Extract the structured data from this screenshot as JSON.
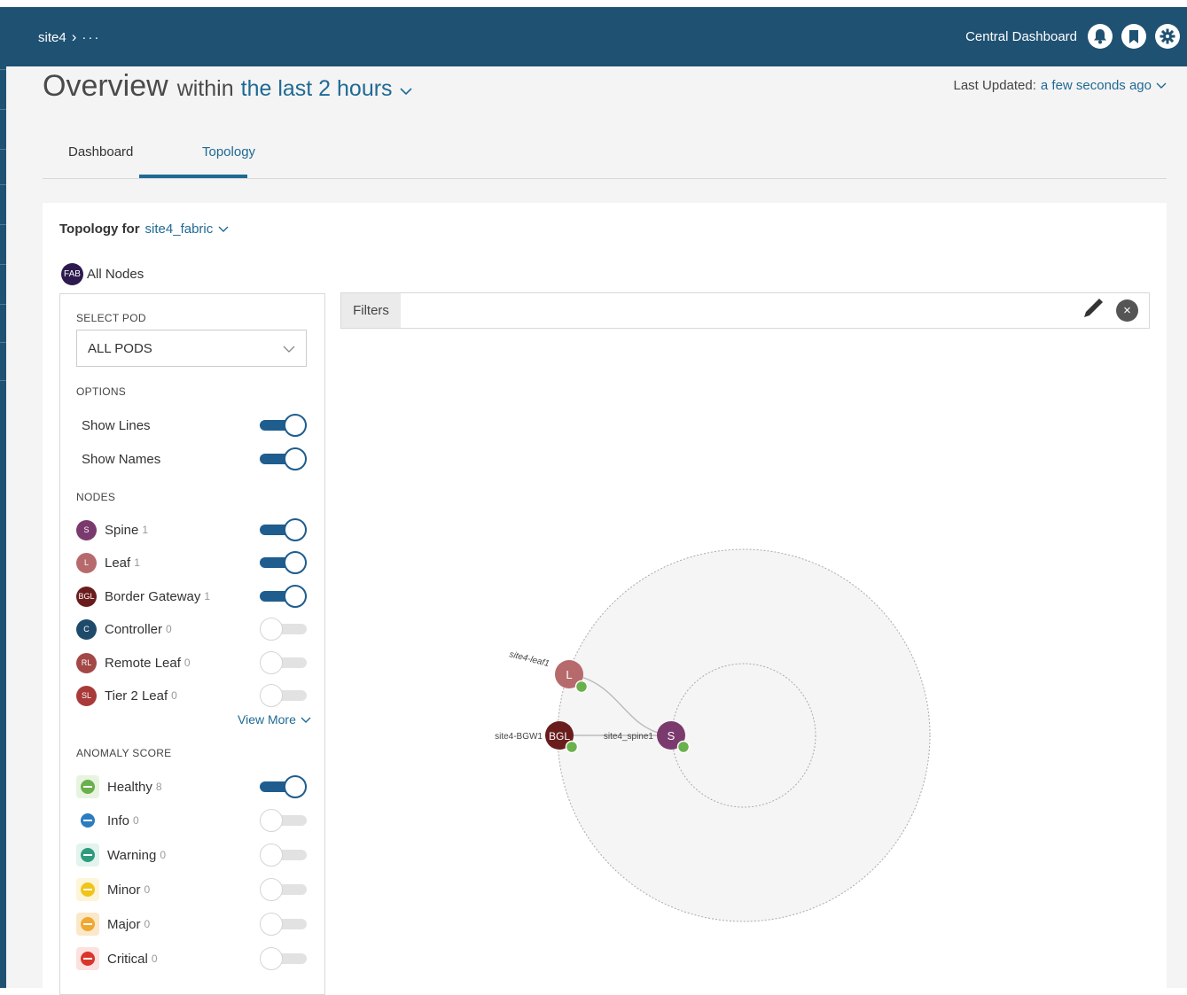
{
  "header": {
    "breadcrumb_site": "site4",
    "breadcrumb_more": "···",
    "central_dashboard": "Central Dashboard",
    "icons": [
      "bell-icon",
      "bookmark-icon",
      "gear-icon"
    ]
  },
  "overview": {
    "title": "Overview",
    "within": "within",
    "time_range": "the last 2 hours",
    "last_updated_label": "Last Updated:",
    "last_updated_value": "a few seconds ago"
  },
  "tabs": [
    {
      "label": "Dashboard",
      "active": false
    },
    {
      "label": "Topology",
      "active": true
    }
  ],
  "topology": {
    "title_prefix": "Topology for",
    "fabric": "site4_fabric",
    "all_nodes_badge": "FAB",
    "all_nodes_label": "All Nodes"
  },
  "panel": {
    "select_pod_label": "SELECT POD",
    "pod_value": "ALL PODS",
    "options_label": "OPTIONS",
    "options": [
      {
        "label": "Show Lines",
        "on": true
      },
      {
        "label": "Show Names",
        "on": true
      }
    ],
    "nodes_label": "NODES",
    "nodes": [
      {
        "badge": "S",
        "label": "Spine",
        "count": "1",
        "color": "#7b3a6e",
        "on": true
      },
      {
        "badge": "L",
        "label": "Leaf",
        "count": "1",
        "color": "#b76a6c",
        "on": true
      },
      {
        "badge": "BGL",
        "label": "Border Gateway",
        "count": "1",
        "color": "#6a1c1c",
        "on": true
      },
      {
        "badge": "C",
        "label": "Controller",
        "count": "0",
        "color": "#1f4b6b",
        "on": false
      },
      {
        "badge": "RL",
        "label": "Remote Leaf",
        "count": "0",
        "color": "#a34747",
        "on": false
      },
      {
        "badge": "SL",
        "label": "Tier 2 Leaf",
        "count": "0",
        "color": "#a83a3a",
        "on": false
      }
    ],
    "view_more": "View More",
    "anomaly_label": "ANOMALY SCORE",
    "anomaly": [
      {
        "label": "Healthy",
        "count": "8",
        "color": "#6ab04c",
        "bg": "#e8f4e0",
        "on": true
      },
      {
        "label": "Info",
        "count": "0",
        "color": "#2b7bbf",
        "bg": "#ffffff",
        "on": false
      },
      {
        "label": "Warning",
        "count": "0",
        "color": "#2f9c7f",
        "bg": "#e3f3ee",
        "on": false
      },
      {
        "label": "Minor",
        "count": "0",
        "color": "#f0c419",
        "bg": "#fdf5d8",
        "on": false
      },
      {
        "label": "Major",
        "count": "0",
        "color": "#f0a830",
        "bg": "#fbe8c8",
        "on": false
      },
      {
        "label": "Critical",
        "count": "0",
        "color": "#d9362b",
        "bg": "#fbe1df",
        "on": false
      }
    ]
  },
  "filters": {
    "label": "Filters"
  },
  "graph": {
    "nodes": [
      {
        "id": "leaf",
        "badge": "L",
        "name": "site4-leaf1",
        "color": "#b76a6c"
      },
      {
        "id": "bgw",
        "badge": "BGL",
        "name": "site4-BGW1",
        "color": "#6a1c1c"
      },
      {
        "id": "spine",
        "badge": "S",
        "name": "site4_spine1",
        "color": "#7b3a6e"
      }
    ],
    "health_color": "#6ab04c"
  }
}
